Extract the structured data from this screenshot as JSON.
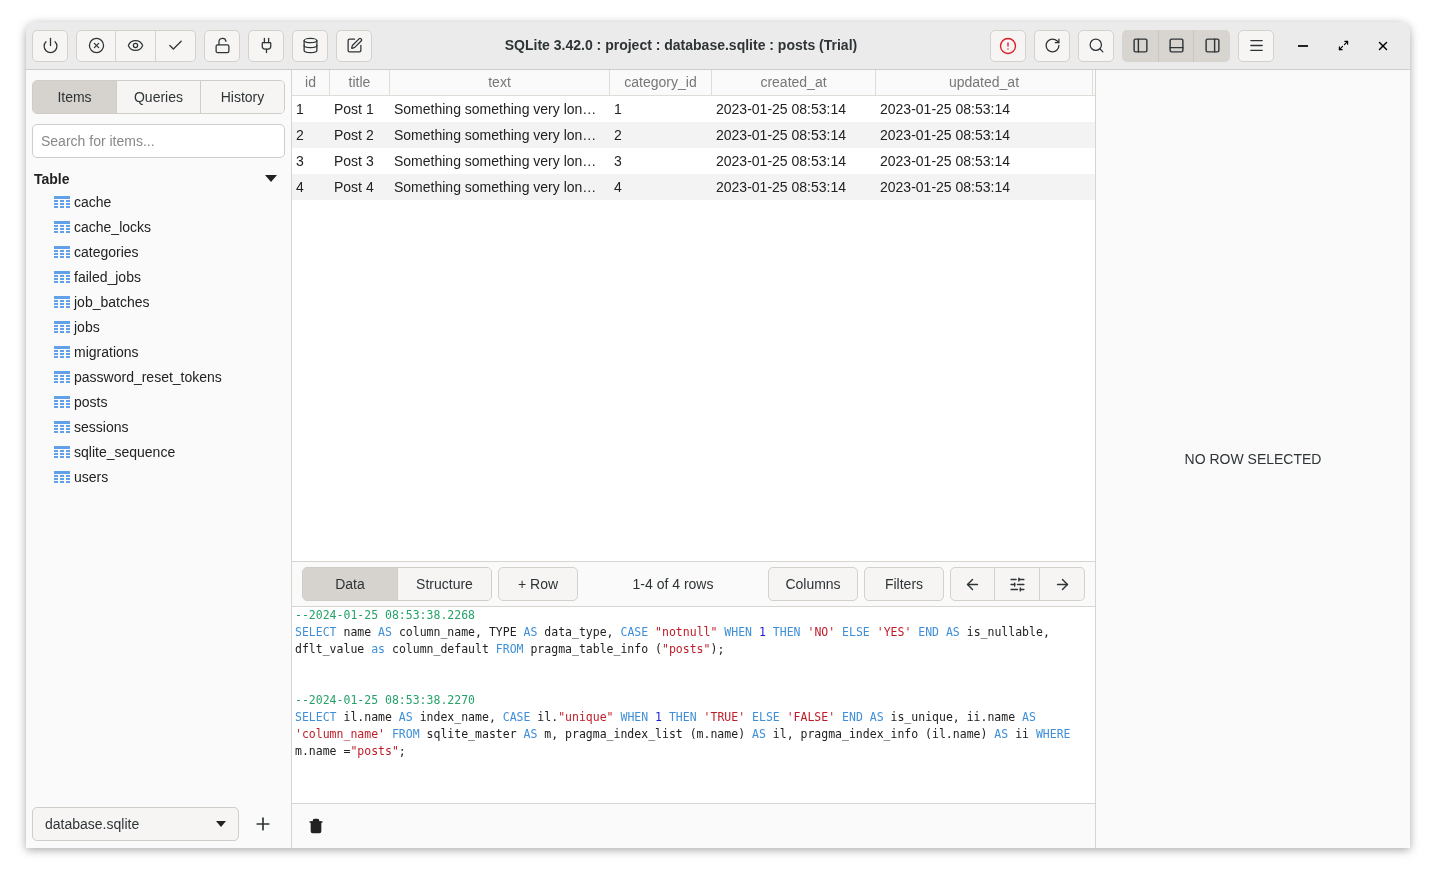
{
  "window": {
    "title": "SQLite 3.42.0 : project : database.sqlite : posts (Trial)"
  },
  "sidebar": {
    "tabs": [
      {
        "label": "Items",
        "selected": true
      },
      {
        "label": "Queries",
        "selected": false
      },
      {
        "label": "History",
        "selected": false
      }
    ],
    "search": {
      "placeholder": "Search for items..."
    },
    "section": {
      "label": "Table",
      "expanded": true
    },
    "items": [
      "cache",
      "cache_locks",
      "categories",
      "failed_jobs",
      "job_batches",
      "jobs",
      "migrations",
      "password_reset_tokens",
      "posts",
      "sessions",
      "sqlite_sequence",
      "users"
    ],
    "database_select": {
      "value": "database.sqlite"
    }
  },
  "table": {
    "columns": [
      "id",
      "title",
      "text",
      "category_id",
      "created_at",
      "updated_at"
    ],
    "rows": [
      [
        "1",
        "Post 1",
        "Something something very lon…",
        "1",
        "2023-01-25 08:53:14",
        "2023-01-25 08:53:14"
      ],
      [
        "2",
        "Post 2",
        "Something something very lon…",
        "2",
        "2023-01-25 08:53:14",
        "2023-01-25 08:53:14"
      ],
      [
        "3",
        "Post 3",
        "Something something very lon…",
        "3",
        "2023-01-25 08:53:14",
        "2023-01-25 08:53:14"
      ],
      [
        "4",
        "Post 4",
        "Something something very lon…",
        "4",
        "2023-01-25 08:53:14",
        "2023-01-25 08:53:14"
      ]
    ]
  },
  "toolbar": {
    "tabs": [
      {
        "label": "Data",
        "selected": true
      },
      {
        "label": "Structure",
        "selected": false
      }
    ],
    "add_row": "+ Row",
    "row_count": "1-4 of 4 rows",
    "columns_button": "Columns",
    "filters_button": "Filters"
  },
  "log": [
    {
      "tokens": [
        {
          "kind": "comment",
          "text": "--2024-01-25 08:53:38.2268"
        }
      ]
    },
    {
      "tokens": [
        {
          "kind": "keyword",
          "text": "SELECT"
        },
        {
          "kind": "plain",
          "text": " name "
        },
        {
          "kind": "keyword",
          "text": "AS"
        },
        {
          "kind": "plain",
          "text": " column_name, TYPE "
        },
        {
          "kind": "keyword",
          "text": "AS"
        },
        {
          "kind": "plain",
          "text": " data_type, "
        },
        {
          "kind": "keyword",
          "text": "CASE "
        },
        {
          "kind": "string",
          "text": "\"notnull\" "
        },
        {
          "kind": "keyword",
          "text": "WHEN "
        },
        {
          "kind": "number",
          "text": "1 "
        },
        {
          "kind": "keyword",
          "text": "THEN "
        },
        {
          "kind": "string",
          "text": "'NO' "
        },
        {
          "kind": "keyword",
          "text": "ELSE "
        },
        {
          "kind": "string",
          "text": "'YES' "
        },
        {
          "kind": "keyword",
          "text": "END AS"
        },
        {
          "kind": "plain",
          "text": " is_nullable, dflt_value "
        },
        {
          "kind": "keyword",
          "text": "as"
        },
        {
          "kind": "plain",
          "text": " column_default "
        },
        {
          "kind": "keyword",
          "text": "FROM"
        },
        {
          "kind": "plain",
          "text": " pragma_table_info ("
        },
        {
          "kind": "string",
          "text": "\"posts\""
        },
        {
          "kind": "plain",
          "text": ");"
        }
      ]
    },
    {
      "tokens": [
        {
          "kind": "comment",
          "text": "--2024-01-25 08:53:38.2270"
        }
      ]
    },
    {
      "tokens": [
        {
          "kind": "keyword",
          "text": "SELECT"
        },
        {
          "kind": "plain",
          "text": " il.name "
        },
        {
          "kind": "keyword",
          "text": "AS"
        },
        {
          "kind": "plain",
          "text": " index_name, "
        },
        {
          "kind": "keyword",
          "text": "CASE"
        },
        {
          "kind": "plain",
          "text": " il."
        },
        {
          "kind": "string",
          "text": "\"unique\" "
        },
        {
          "kind": "keyword",
          "text": "WHEN "
        },
        {
          "kind": "number",
          "text": "1 "
        },
        {
          "kind": "keyword",
          "text": "THEN "
        },
        {
          "kind": "string",
          "text": "'TRUE' "
        },
        {
          "kind": "keyword",
          "text": "ELSE "
        },
        {
          "kind": "string",
          "text": "'FALSE' "
        },
        {
          "kind": "keyword",
          "text": "END AS"
        },
        {
          "kind": "plain",
          "text": " is_unique, ii.name "
        },
        {
          "kind": "keyword",
          "text": "AS "
        },
        {
          "kind": "string",
          "text": "'column_name' "
        },
        {
          "kind": "keyword",
          "text": "FROM"
        },
        {
          "kind": "plain",
          "text": " sqlite_master "
        },
        {
          "kind": "keyword",
          "text": "AS"
        },
        {
          "kind": "plain",
          "text": " m, pragma_index_list (m.name) "
        },
        {
          "kind": "keyword",
          "text": "AS"
        },
        {
          "kind": "plain",
          "text": " il, pragma_index_info (il.name) "
        },
        {
          "kind": "keyword",
          "text": "AS"
        },
        {
          "kind": "plain",
          "text": " ii "
        },
        {
          "kind": "keyword",
          "text": "WHERE"
        },
        {
          "kind": "plain",
          "text": " m.name ="
        },
        {
          "kind": "string",
          "text": "\"posts\""
        },
        {
          "kind": "plain",
          "text": ";"
        }
      ]
    }
  ],
  "details": {
    "empty_message": "NO ROW SELECTED"
  }
}
